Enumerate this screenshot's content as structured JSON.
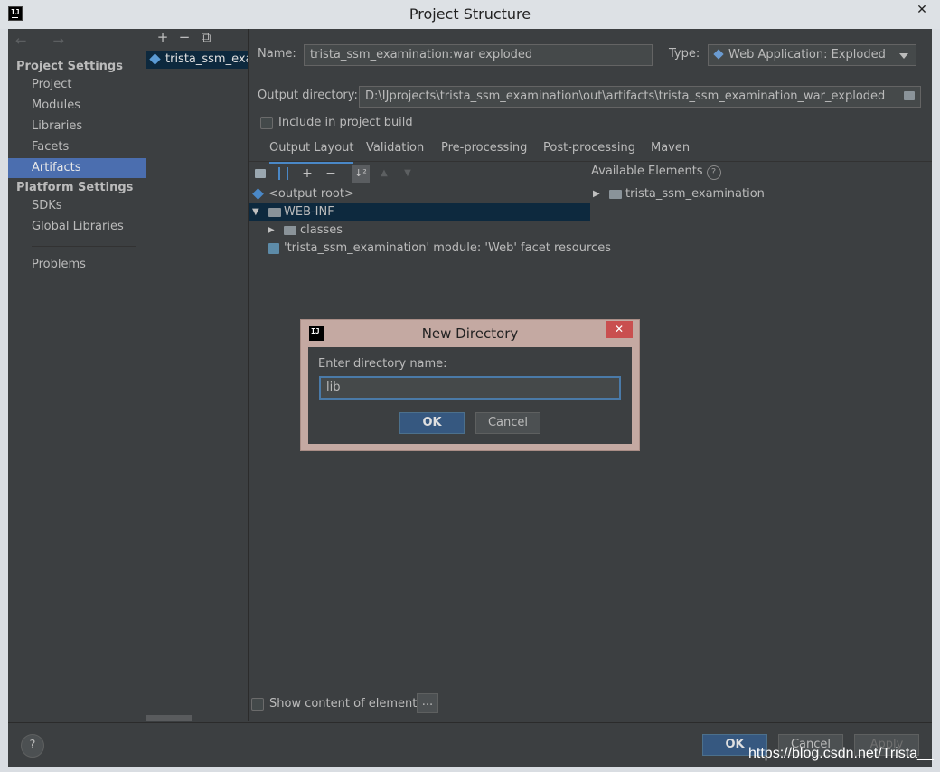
{
  "window": {
    "title": "Project Structure",
    "close_label": "✕",
    "app_icon_text": "IJ"
  },
  "nav": {
    "back_forward": "← →",
    "project_settings_header": "Project Settings",
    "project_items": [
      "Project",
      "Modules",
      "Libraries",
      "Facets",
      "Artifacts"
    ],
    "selected_item": "Artifacts",
    "platform_settings_header": "Platform Settings",
    "platform_items": [
      "SDKs",
      "Global Libraries"
    ],
    "problems": "Problems"
  },
  "artifacts": {
    "toolbar": [
      "+",
      "−",
      "⧉"
    ],
    "items": [
      "trista_ssm_examination:war exploded"
    ]
  },
  "form": {
    "name_label": "Name:",
    "name_value": "trista_ssm_examination:war exploded",
    "type_label": "Type:",
    "type_value": "Web Application: Exploded",
    "output_label": "Output directory:",
    "output_value": "D:\\IJprojects\\trista_ssm_examination\\out\\artifacts\\trista_ssm_examination_war_exploded",
    "include_label": "Include in project build",
    "include_checked": false
  },
  "tabs": {
    "items": [
      "Output Layout",
      "Validation",
      "Pre-processing",
      "Post-processing",
      "Maven"
    ],
    "selected": "Output Layout"
  },
  "layout_tree": {
    "toolbar_plus": "+",
    "toolbar_minus": "−",
    "toolbar_sort": "↓²",
    "toolbar_up": "▲",
    "toolbar_down": "▼",
    "rows": [
      {
        "label": "<output root>"
      },
      {
        "label": "WEB-INF"
      },
      {
        "label": "classes"
      },
      {
        "label": "'trista_ssm_examination' module: 'Web' facet resources"
      }
    ]
  },
  "available": {
    "header": "Available Elements",
    "help": "?",
    "items": [
      "trista_ssm_examination"
    ]
  },
  "show_content": {
    "label": "Show content of elements",
    "button": "..."
  },
  "footer": {
    "help": "?",
    "ok": "OK",
    "cancel": "Cancel",
    "apply": "Apply"
  },
  "dialog": {
    "title": "New Directory",
    "logo": "IJ",
    "close": "✕",
    "prompt": "Enter directory name:",
    "value": "lib",
    "ok": "OK",
    "cancel": "Cancel"
  },
  "watermark": "https://blog.csdn.net/Trista__"
}
